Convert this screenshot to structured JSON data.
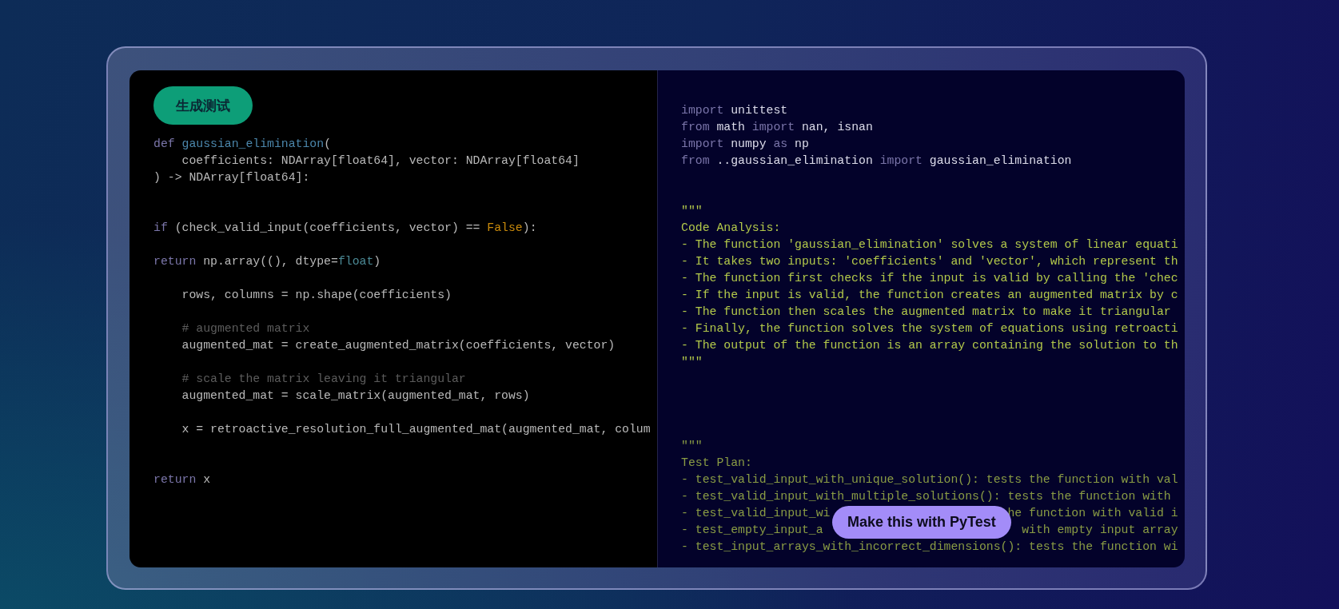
{
  "left_panel": {
    "generate_button": {
      "label": "生成测试"
    },
    "code_lines": [
      {
        "kind": "code",
        "tokens": [
          {
            "kind": "kw",
            "text": "def "
          },
          {
            "kind": "fn",
            "text": "gaussian_elimination"
          },
          {
            "kind": "text",
            "text": "("
          }
        ]
      },
      {
        "kind": "code",
        "tokens": [
          {
            "kind": "text",
            "text": "    coefficients: NDArray[float64], vector: NDArray[float64]"
          }
        ]
      },
      {
        "kind": "code",
        "tokens": [
          {
            "kind": "text",
            "text": ") -> NDArray[float64]:"
          }
        ]
      },
      {
        "kind": "blank"
      },
      {
        "kind": "blank"
      },
      {
        "kind": "code",
        "tokens": [
          {
            "kind": "kw",
            "text": "if "
          },
          {
            "kind": "text",
            "text": "(check_valid_input(coefficients, vector) == "
          },
          {
            "kind": "const",
            "text": "False"
          },
          {
            "kind": "text",
            "text": "):"
          }
        ]
      },
      {
        "kind": "blank"
      },
      {
        "kind": "code",
        "tokens": [
          {
            "kind": "kw",
            "text": "return "
          },
          {
            "kind": "text",
            "text": "np.array((), dtype="
          },
          {
            "kind": "builtin",
            "text": "float"
          },
          {
            "kind": "text",
            "text": ")"
          }
        ]
      },
      {
        "kind": "blank"
      },
      {
        "kind": "code",
        "tokens": [
          {
            "kind": "text",
            "text": "    rows, columns = np.shape(coefficients)"
          }
        ]
      },
      {
        "kind": "blank"
      },
      {
        "kind": "code",
        "tokens": [
          {
            "kind": "comment",
            "text": "    # augmented matrix"
          }
        ]
      },
      {
        "kind": "code",
        "tokens": [
          {
            "kind": "text",
            "text": "    augmented_mat = create_augmented_matrix(coefficients, vector)"
          }
        ]
      },
      {
        "kind": "blank"
      },
      {
        "kind": "code",
        "tokens": [
          {
            "kind": "comment",
            "text": "    # scale the matrix leaving it triangular"
          }
        ]
      },
      {
        "kind": "code",
        "tokens": [
          {
            "kind": "text",
            "text": "    augmented_mat = scale_matrix(augmented_mat, rows)"
          }
        ]
      },
      {
        "kind": "blank"
      },
      {
        "kind": "code",
        "tokens": [
          {
            "kind": "text",
            "text": "    x = retroactive_resolution_full_augmented_mat(augmented_mat, colum"
          }
        ]
      },
      {
        "kind": "blank"
      },
      {
        "kind": "blank"
      },
      {
        "kind": "code",
        "tokens": [
          {
            "kind": "kw",
            "text": "return "
          },
          {
            "kind": "text",
            "text": "x"
          }
        ]
      }
    ]
  },
  "right_panel": {
    "code_lines": [
      {
        "kind": "code",
        "tokens": [
          {
            "kind": "kw",
            "text": "import "
          },
          {
            "kind": "name",
            "text": "unittest"
          }
        ]
      },
      {
        "kind": "code",
        "tokens": [
          {
            "kind": "kw",
            "text": "from "
          },
          {
            "kind": "name",
            "text": "math "
          },
          {
            "kind": "kw",
            "text": "import "
          },
          {
            "kind": "name",
            "text": "nan, isnan"
          }
        ]
      },
      {
        "kind": "code",
        "tokens": [
          {
            "kind": "kw",
            "text": "import "
          },
          {
            "kind": "name",
            "text": "numpy "
          },
          {
            "kind": "kw",
            "text": "as "
          },
          {
            "kind": "name",
            "text": "np"
          }
        ]
      },
      {
        "kind": "code",
        "tokens": [
          {
            "kind": "kw",
            "text": "from "
          },
          {
            "kind": "name",
            "text": "..gaussian_elimination "
          },
          {
            "kind": "kw",
            "text": "import "
          },
          {
            "kind": "name",
            "text": "gaussian_elimination"
          }
        ]
      },
      {
        "kind": "blank"
      },
      {
        "kind": "blank"
      },
      {
        "kind": "code",
        "tokens": [
          {
            "kind": "doc",
            "text": "\"\"\""
          }
        ]
      },
      {
        "kind": "code",
        "tokens": [
          {
            "kind": "doc",
            "text": "Code Analysis:"
          }
        ]
      },
      {
        "kind": "code",
        "tokens": [
          {
            "kind": "doc",
            "text": "- The function 'gaussian_elimination' solves a system of linear equati"
          }
        ]
      },
      {
        "kind": "code",
        "tokens": [
          {
            "kind": "doc",
            "text": "- It takes two inputs: 'coefficients' and 'vector', which represent th"
          }
        ]
      },
      {
        "kind": "code",
        "tokens": [
          {
            "kind": "doc",
            "text": "- The function first checks if the input is valid by calling the 'chec"
          }
        ]
      },
      {
        "kind": "code",
        "tokens": [
          {
            "kind": "doc",
            "text": "- If the input is valid, the function creates an augmented matrix by c"
          }
        ]
      },
      {
        "kind": "code",
        "tokens": [
          {
            "kind": "doc",
            "text": "- The function then scales the augmented matrix to make it triangular"
          }
        ]
      },
      {
        "kind": "code",
        "tokens": [
          {
            "kind": "doc",
            "text": "- Finally, the function solves the system of equations using retroacti"
          }
        ]
      },
      {
        "kind": "code",
        "tokens": [
          {
            "kind": "doc",
            "text": "- The output of the function is an array containing the solution to th"
          }
        ]
      },
      {
        "kind": "code",
        "tokens": [
          {
            "kind": "doc",
            "text": "\"\"\""
          }
        ]
      },
      {
        "kind": "blank"
      },
      {
        "kind": "blank"
      },
      {
        "kind": "blank"
      },
      {
        "kind": "blank"
      },
      {
        "kind": "code",
        "tokens": [
          {
            "kind": "plan",
            "text": "\"\"\""
          }
        ]
      },
      {
        "kind": "code",
        "tokens": [
          {
            "kind": "plan",
            "text": "Test Plan:"
          }
        ]
      },
      {
        "kind": "code",
        "tokens": [
          {
            "kind": "plan",
            "text": "- test_valid_input_with_unique_solution(): tests the function with val"
          }
        ]
      },
      {
        "kind": "code",
        "tokens": [
          {
            "kind": "plan",
            "text": "- test_valid_input_with_multiple_solutions(): tests the function with"
          }
        ]
      },
      {
        "kind": "split",
        "segments": [
          "- test_valid_input_wi",
          "he function with valid i"
        ]
      },
      {
        "kind": "split",
        "segments": [
          "- test_empty_input_a",
          "with empty input array"
        ]
      },
      {
        "kind": "code",
        "tokens": [
          {
            "kind": "plan",
            "text": "- test_input_arrays_with_incorrect_dimensions(): tests the function wi"
          }
        ]
      }
    ],
    "pytest_button": {
      "label": "Make this with PyTest"
    }
  }
}
